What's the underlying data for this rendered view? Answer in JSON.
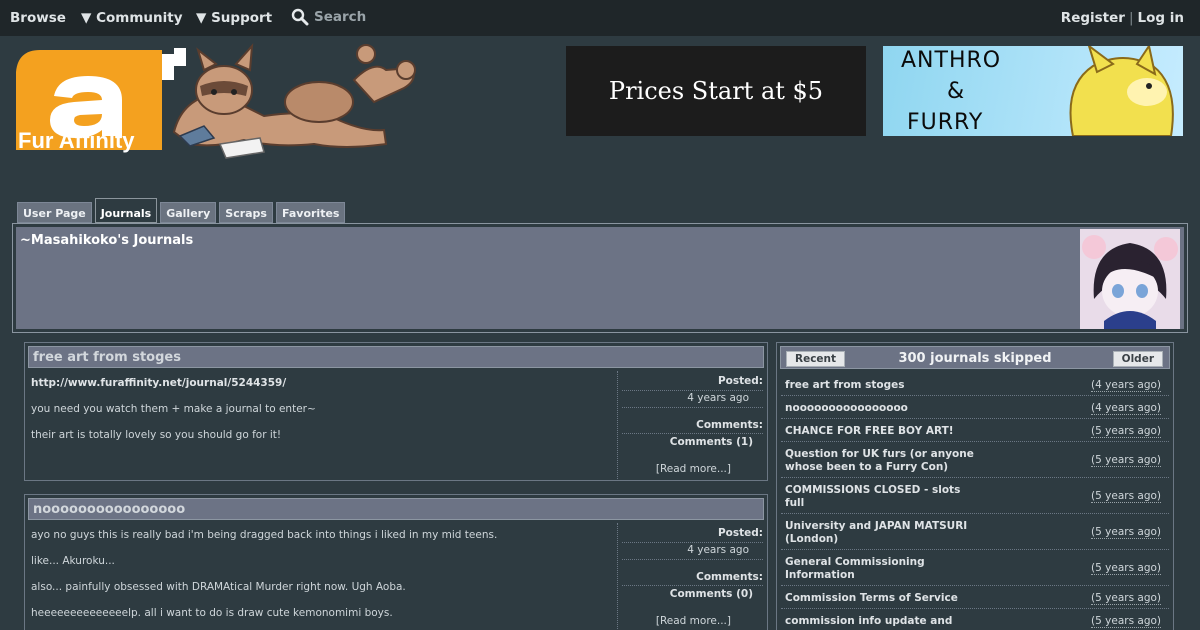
{
  "nav": {
    "browse": "Browse",
    "community": "▼ Community",
    "support": "▼ Support",
    "search": "Search",
    "register": "Register",
    "separator": "|",
    "login": "Log in"
  },
  "logo": {
    "text": "Fur Affinity"
  },
  "banners": {
    "left_text": "Prices Start at $5",
    "right_line1": "ANTHRO",
    "right_line2": "&",
    "right_line3": "FURRY"
  },
  "tabs": [
    "User Page",
    "Journals",
    "Gallery",
    "Scraps",
    "Favorites"
  ],
  "profile": {
    "title": "~Masahikoko's Journals"
  },
  "journals": [
    {
      "title": "free art from stoges",
      "lines": [
        "http://www.furaffinity.net/journal/5244359/",
        "you need you watch them + make a journal to enter~",
        "their art is totally lovely so you should go for it!"
      ],
      "posted_label": "Posted:",
      "posted": "4 years ago",
      "comments_label": "Comments:",
      "comments": "Comments (1)",
      "read_more": "[Read more...]"
    },
    {
      "title": "noooooooooooooooo",
      "lines": [
        "ayo no guys this is really bad i'm being dragged back into things i liked in my mid teens.",
        "like... Akuroku...",
        "also... painfully obsessed with DRAMAtical Murder right now. Ugh Aoba.",
        "heeeeeeeeeeeeeelp. all i want to do is draw cute kemonomimi boys."
      ],
      "posted_label": "Posted:",
      "posted": "4 years ago",
      "comments_label": "Comments:",
      "comments": "Comments (0)",
      "read_more": "[Read more...]"
    }
  ],
  "recent_panel": {
    "recent_button": "Recent",
    "title": "300 journals skipped",
    "older_button": "Older",
    "items": [
      {
        "title": "free art from stoges",
        "date": "(4 years ago)"
      },
      {
        "title": "noooooooooooooooo",
        "date": "(4 years ago)"
      },
      {
        "title": "CHANCE FOR FREE BOY ART!",
        "date": "(5 years ago)"
      },
      {
        "title": "Question for UK furs (or anyone whose been to a Furry Con)",
        "date": "(5 years ago)"
      },
      {
        "title": "COMMISSIONS CLOSED - slots full",
        "date": "(5 years ago)"
      },
      {
        "title": "University and JAPAN MATSURI (London)",
        "date": "(5 years ago)"
      },
      {
        "title": "General Commissioning Information",
        "date": "(5 years ago)"
      },
      {
        "title": "Commission Terms of Service",
        "date": "(5 years ago)"
      },
      {
        "title": "commission info update and",
        "date": "(5 years ago)"
      }
    ]
  },
  "colors": {
    "page_bg": "#2e3b41",
    "nav_bg": "#1f2629",
    "panel_header": "#6c7385",
    "logo_orange": "#f4a11f"
  }
}
